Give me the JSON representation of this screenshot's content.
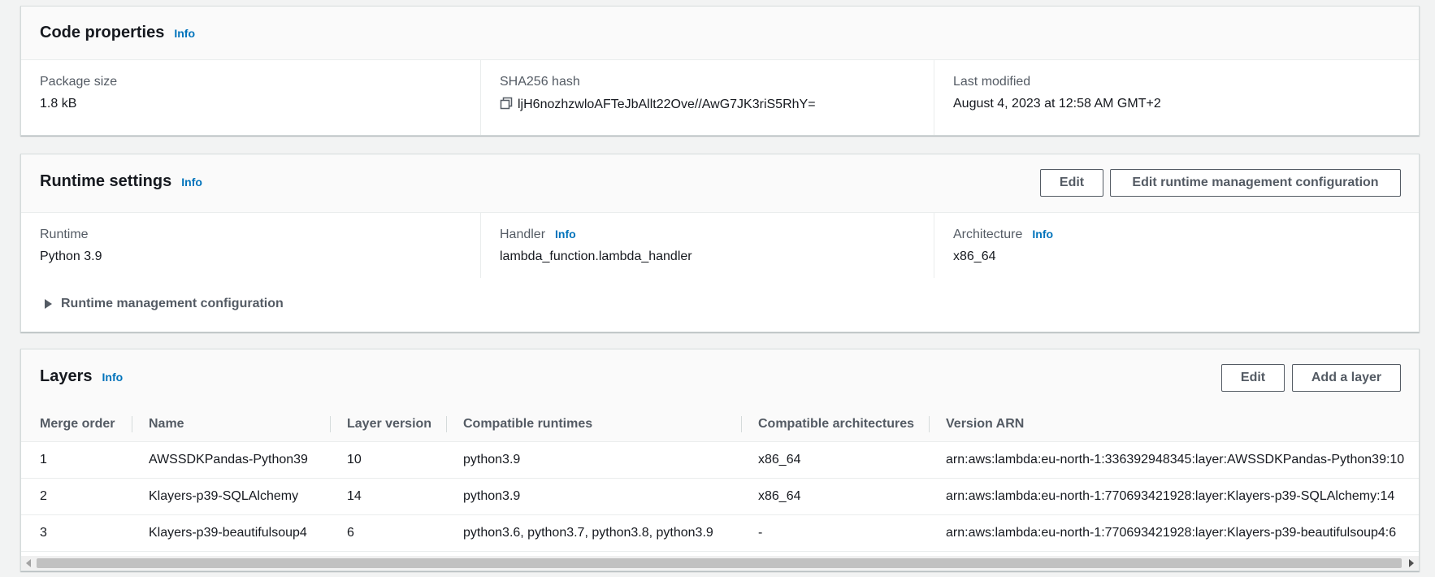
{
  "code_properties": {
    "title": "Code properties",
    "info": "Info",
    "package_size_label": "Package size",
    "package_size": "1.8 kB",
    "sha_label": "SHA256 hash",
    "sha_value": "ljH6nozhzwloAFTeJbAllt22Ove//AwG7JK3riS5RhY=",
    "copy_icon": "copy-icon",
    "last_modified_label": "Last modified",
    "last_modified": "August 4, 2023 at 12:58 AM GMT+2"
  },
  "runtime_settings": {
    "title": "Runtime settings",
    "info": "Info",
    "edit_label": "Edit",
    "edit_runtime_mgmt_label": "Edit runtime management configuration",
    "runtime_label": "Runtime",
    "runtime": "Python 3.9",
    "handler_label": "Handler",
    "handler_info": "Info",
    "handler": "lambda_function.lambda_handler",
    "architecture_label": "Architecture",
    "architecture_info": "Info",
    "architecture": "x86_64",
    "expander_label": "Runtime management configuration"
  },
  "layers": {
    "title": "Layers",
    "info": "Info",
    "edit_label": "Edit",
    "add_label": "Add a layer",
    "columns": [
      "Merge order",
      "Name",
      "Layer version",
      "Compatible runtimes",
      "Compatible architectures",
      "Version ARN"
    ],
    "rows": [
      [
        "1",
        "AWSSDKPandas-Python39",
        "10",
        "python3.9",
        "x86_64",
        "arn:aws:lambda:eu-north-1:336392948345:layer:AWSSDKPandas-Python39:10"
      ],
      [
        "2",
        "Klayers-p39-SQLAlchemy",
        "14",
        "python3.9",
        "x86_64",
        "arn:aws:lambda:eu-north-1:770693421928:layer:Klayers-p39-SQLAlchemy:14"
      ],
      [
        "3",
        "Klayers-p39-beautifulsoup4",
        "6",
        "python3.6, python3.7, python3.8, python3.9",
        "-",
        "arn:aws:lambda:eu-north-1:770693421928:layer:Klayers-p39-beautifulsoup4:6"
      ]
    ]
  },
  "colors": {
    "link": "#0073bb",
    "text": "#16191f",
    "secondary_text": "#545b64",
    "background": "#f2f3f3"
  }
}
